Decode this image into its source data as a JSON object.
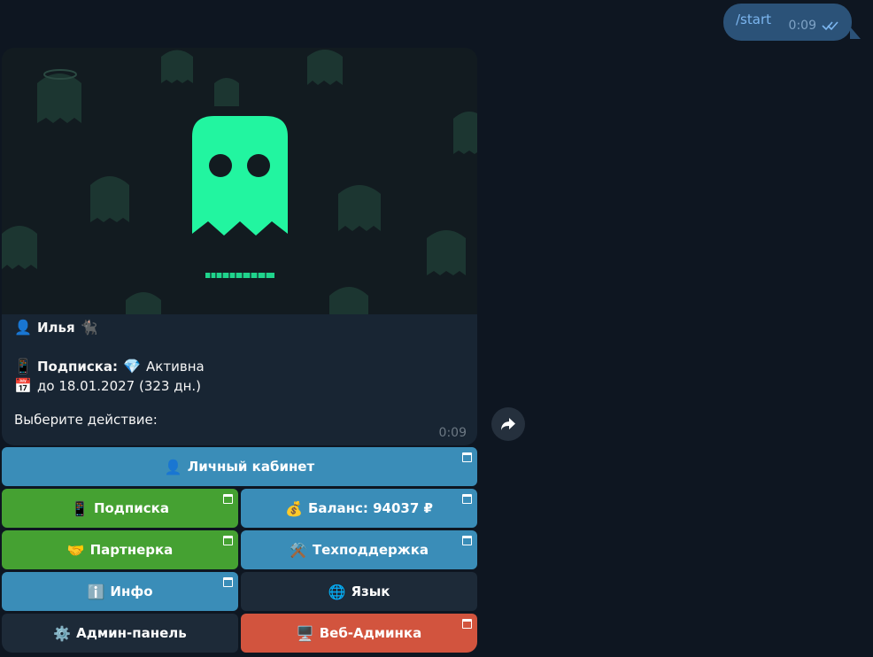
{
  "outgoing": {
    "text": "/start",
    "time": "0:09",
    "status_icon": "double-check-icon"
  },
  "incoming": {
    "media": {
      "icon": "ghost-icon",
      "primary_color": "#22f5a0",
      "background_color": "#121b20"
    },
    "caption": {
      "user_icon": "👤",
      "user_name": "Илья",
      "user_suffix": "🐈‍⬛",
      "sub_icon": "📱",
      "sub_label": "Подписка:",
      "sub_state_icon": "💎",
      "sub_state": "Активна",
      "date_icon": "📅",
      "date_text": "до 18.01.2027 (323 дн.)",
      "prompt": "Выберите действие:"
    },
    "time": "0:09"
  },
  "keyboard": {
    "rows": [
      [
        {
          "icon": "👤",
          "label": "Личный кабинет"
        }
      ],
      [
        {
          "icon": "📱",
          "label": "Подписка"
        },
        {
          "icon": "💰",
          "label": "Баланс: 94037 ₽"
        }
      ],
      [
        {
          "icon": "🤝",
          "label": "Партнерка"
        },
        {
          "icon": "⚒️",
          "label": "Техподдержка"
        }
      ],
      [
        {
          "icon": "ℹ️",
          "label": "Инфо"
        },
        {
          "icon": "🌐",
          "label": "Язык"
        }
      ],
      [
        {
          "icon": "⚙️",
          "label": "Админ-панель"
        },
        {
          "icon": "🖥️",
          "label": "Веб-Админка"
        }
      ]
    ]
  },
  "colors": {
    "app_bg": "#0e1621",
    "bubble_out": "#2b5278",
    "bubble_in": "#182533",
    "btn_blue": "#3a8db8",
    "btn_green": "#45a132",
    "btn_dark": "#1d2a38",
    "btn_red": "#d2543e"
  }
}
